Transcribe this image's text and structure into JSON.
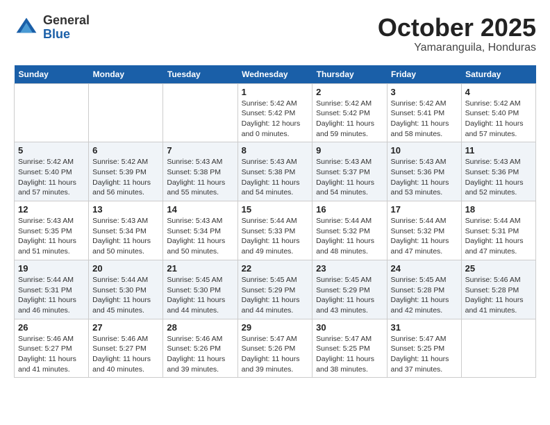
{
  "header": {
    "logo_general": "General",
    "logo_blue": "Blue",
    "month_title": "October 2025",
    "subtitle": "Yamaranguila, Honduras"
  },
  "weekdays": [
    "Sunday",
    "Monday",
    "Tuesday",
    "Wednesday",
    "Thursday",
    "Friday",
    "Saturday"
  ],
  "weeks": [
    [
      {
        "day": "",
        "info": ""
      },
      {
        "day": "",
        "info": ""
      },
      {
        "day": "",
        "info": ""
      },
      {
        "day": "1",
        "info": "Sunrise: 5:42 AM\nSunset: 5:42 PM\nDaylight: 12 hours\nand 0 minutes."
      },
      {
        "day": "2",
        "info": "Sunrise: 5:42 AM\nSunset: 5:42 PM\nDaylight: 11 hours\nand 59 minutes."
      },
      {
        "day": "3",
        "info": "Sunrise: 5:42 AM\nSunset: 5:41 PM\nDaylight: 11 hours\nand 58 minutes."
      },
      {
        "day": "4",
        "info": "Sunrise: 5:42 AM\nSunset: 5:40 PM\nDaylight: 11 hours\nand 57 minutes."
      }
    ],
    [
      {
        "day": "5",
        "info": "Sunrise: 5:42 AM\nSunset: 5:40 PM\nDaylight: 11 hours\nand 57 minutes."
      },
      {
        "day": "6",
        "info": "Sunrise: 5:42 AM\nSunset: 5:39 PM\nDaylight: 11 hours\nand 56 minutes."
      },
      {
        "day": "7",
        "info": "Sunrise: 5:43 AM\nSunset: 5:38 PM\nDaylight: 11 hours\nand 55 minutes."
      },
      {
        "day": "8",
        "info": "Sunrise: 5:43 AM\nSunset: 5:38 PM\nDaylight: 11 hours\nand 54 minutes."
      },
      {
        "day": "9",
        "info": "Sunrise: 5:43 AM\nSunset: 5:37 PM\nDaylight: 11 hours\nand 54 minutes."
      },
      {
        "day": "10",
        "info": "Sunrise: 5:43 AM\nSunset: 5:36 PM\nDaylight: 11 hours\nand 53 minutes."
      },
      {
        "day": "11",
        "info": "Sunrise: 5:43 AM\nSunset: 5:36 PM\nDaylight: 11 hours\nand 52 minutes."
      }
    ],
    [
      {
        "day": "12",
        "info": "Sunrise: 5:43 AM\nSunset: 5:35 PM\nDaylight: 11 hours\nand 51 minutes."
      },
      {
        "day": "13",
        "info": "Sunrise: 5:43 AM\nSunset: 5:34 PM\nDaylight: 11 hours\nand 50 minutes."
      },
      {
        "day": "14",
        "info": "Sunrise: 5:43 AM\nSunset: 5:34 PM\nDaylight: 11 hours\nand 50 minutes."
      },
      {
        "day": "15",
        "info": "Sunrise: 5:44 AM\nSunset: 5:33 PM\nDaylight: 11 hours\nand 49 minutes."
      },
      {
        "day": "16",
        "info": "Sunrise: 5:44 AM\nSunset: 5:32 PM\nDaylight: 11 hours\nand 48 minutes."
      },
      {
        "day": "17",
        "info": "Sunrise: 5:44 AM\nSunset: 5:32 PM\nDaylight: 11 hours\nand 47 minutes."
      },
      {
        "day": "18",
        "info": "Sunrise: 5:44 AM\nSunset: 5:31 PM\nDaylight: 11 hours\nand 47 minutes."
      }
    ],
    [
      {
        "day": "19",
        "info": "Sunrise: 5:44 AM\nSunset: 5:31 PM\nDaylight: 11 hours\nand 46 minutes."
      },
      {
        "day": "20",
        "info": "Sunrise: 5:44 AM\nSunset: 5:30 PM\nDaylight: 11 hours\nand 45 minutes."
      },
      {
        "day": "21",
        "info": "Sunrise: 5:45 AM\nSunset: 5:30 PM\nDaylight: 11 hours\nand 44 minutes."
      },
      {
        "day": "22",
        "info": "Sunrise: 5:45 AM\nSunset: 5:29 PM\nDaylight: 11 hours\nand 44 minutes."
      },
      {
        "day": "23",
        "info": "Sunrise: 5:45 AM\nSunset: 5:29 PM\nDaylight: 11 hours\nand 43 minutes."
      },
      {
        "day": "24",
        "info": "Sunrise: 5:45 AM\nSunset: 5:28 PM\nDaylight: 11 hours\nand 42 minutes."
      },
      {
        "day": "25",
        "info": "Sunrise: 5:46 AM\nSunset: 5:28 PM\nDaylight: 11 hours\nand 41 minutes."
      }
    ],
    [
      {
        "day": "26",
        "info": "Sunrise: 5:46 AM\nSunset: 5:27 PM\nDaylight: 11 hours\nand 41 minutes."
      },
      {
        "day": "27",
        "info": "Sunrise: 5:46 AM\nSunset: 5:27 PM\nDaylight: 11 hours\nand 40 minutes."
      },
      {
        "day": "28",
        "info": "Sunrise: 5:46 AM\nSunset: 5:26 PM\nDaylight: 11 hours\nand 39 minutes."
      },
      {
        "day": "29",
        "info": "Sunrise: 5:47 AM\nSunset: 5:26 PM\nDaylight: 11 hours\nand 39 minutes."
      },
      {
        "day": "30",
        "info": "Sunrise: 5:47 AM\nSunset: 5:25 PM\nDaylight: 11 hours\nand 38 minutes."
      },
      {
        "day": "31",
        "info": "Sunrise: 5:47 AM\nSunset: 5:25 PM\nDaylight: 11 hours\nand 37 minutes."
      },
      {
        "day": "",
        "info": ""
      }
    ]
  ]
}
